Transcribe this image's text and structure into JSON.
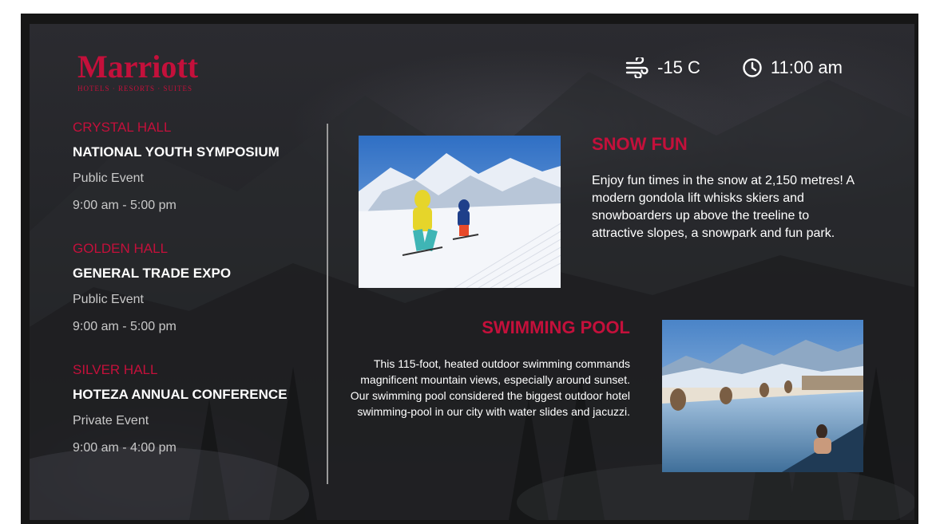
{
  "brand": {
    "name": "Marriott",
    "tagline": "HOTELS · RESORTS · SUITES",
    "color": "#c4103b"
  },
  "status": {
    "weather_icon": "wind-icon",
    "temperature": "-15 C",
    "clock_icon": "clock-icon",
    "time": "11:00 am"
  },
  "events": [
    {
      "hall": "CRYSTAL HALL",
      "title": "NATIONAL YOUTH SYMPOSIUM",
      "type": "Public Event",
      "time": "9:00 am - 5:00 pm"
    },
    {
      "hall": "GOLDEN HALL",
      "title": "GENERAL TRADE EXPO",
      "type": "Public Event",
      "time": "9:00 am - 5:00 pm"
    },
    {
      "hall": "SILVER HALL",
      "title": "HOTEZA ANNUAL CONFERENCE",
      "type": "Private Event",
      "time": "9:00 am - 4:00 pm"
    }
  ],
  "features": {
    "snow": {
      "title": "SNOW FUN",
      "description": "Enjoy fun times in the snow at 2,150 metres! A modern gondola lift whisks skiers and snowboarders up above the treeline to attractive slopes, a snowpark and fun park."
    },
    "pool": {
      "title": "SWIMMING POOL",
      "description": "This 115-foot, heated outdoor swimming commands magnificent mountain views, especially around sunset. Our swimming pool considered the biggest outdoor hotel swimming-pool in our city with water slides and jacuzzi."
    }
  }
}
